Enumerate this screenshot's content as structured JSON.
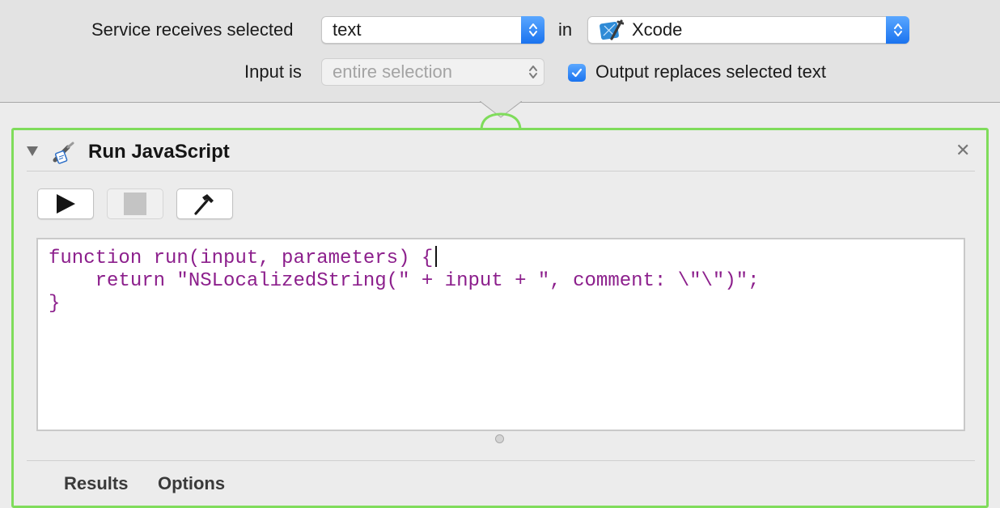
{
  "service": {
    "receives_label": "Service receives selected",
    "input_type": "text",
    "in_label": "in",
    "application": "Xcode",
    "input_is_label": "Input is",
    "input_is_value": "entire selection",
    "output_replaces_label": "Output replaces selected text",
    "output_replaces_checked": true
  },
  "action": {
    "title": "Run JavaScript",
    "close_glyph": "✕",
    "toolbar": {
      "run_icon": "play-icon",
      "stop_icon": "stop-icon",
      "compile_icon": "hammer-icon"
    },
    "code_lines": [
      "function run(input, parameters) {",
      "    return \"NSLocalizedString(\" + input + \", comment: \\\"\\\")\";",
      "}"
    ],
    "footer_tabs": [
      "Results",
      "Options"
    ]
  },
  "colors": {
    "accent_blue": "#1a73ef",
    "active_border_green": "#7fdc5b",
    "code_purple": "#8c1f8c"
  }
}
